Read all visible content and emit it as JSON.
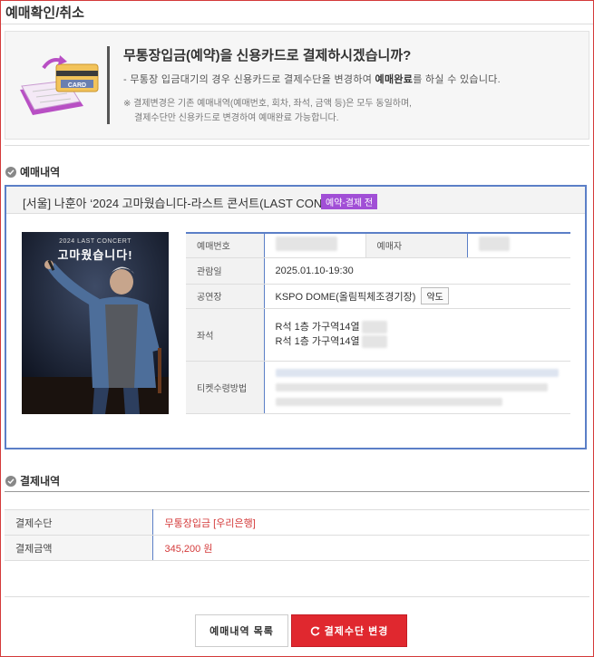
{
  "page": {
    "title": "예매확인/취소"
  },
  "notice": {
    "headline": "무통장입금(예약)을 신용카드로 결제하시겠습니까?",
    "subline_prefix": "- 무통장 입금대기의 경우 신용카드로 결제수단을 변경하여 ",
    "subline_bold": "예매완료",
    "subline_suffix": "를 하실 수 있습니다.",
    "note_line1": "※ 결제변경은 기존 예매내역(예매번호, 회차, 좌석, 금액 등)은 모두 동일하며,",
    "note_line2": "결제수단만 신용카드로 변경하여 예매완료 가능합니다.",
    "illust_label": "CARD"
  },
  "reservation_section": {
    "title": "예매내역"
  },
  "reservation": {
    "show_title": "[서울] 나훈아 ‘2024 고마웠습니다-라스트 콘서트(LAST CON..",
    "status_badge": "예약-결제 전",
    "poster": {
      "top_text": "2024 LAST CONCERT",
      "title_text": "고마웠습니다!"
    },
    "labels": {
      "booking_no": "예매번호",
      "booker": "예매자",
      "date": "관람일",
      "venue": "공연장",
      "seats": "좌석",
      "ticket_method": "티켓수령방법"
    },
    "date_value": "2025.01.10-19:30",
    "venue_value": "KSPO DOME(올림픽체조경기장)",
    "map_button": "약도",
    "seats": [
      "R석 1층 가구역14열",
      "R석 1층 가구역14열"
    ]
  },
  "payment_section": {
    "title": "결제내역"
  },
  "payment": {
    "method_label": "결제수단",
    "method_value": "무통장입금 [우리은행]",
    "amount_label": "결제금액",
    "amount_value": "345,200 원"
  },
  "buttons": {
    "list": "예매내역 목록",
    "change": "결제수단 변경"
  }
}
